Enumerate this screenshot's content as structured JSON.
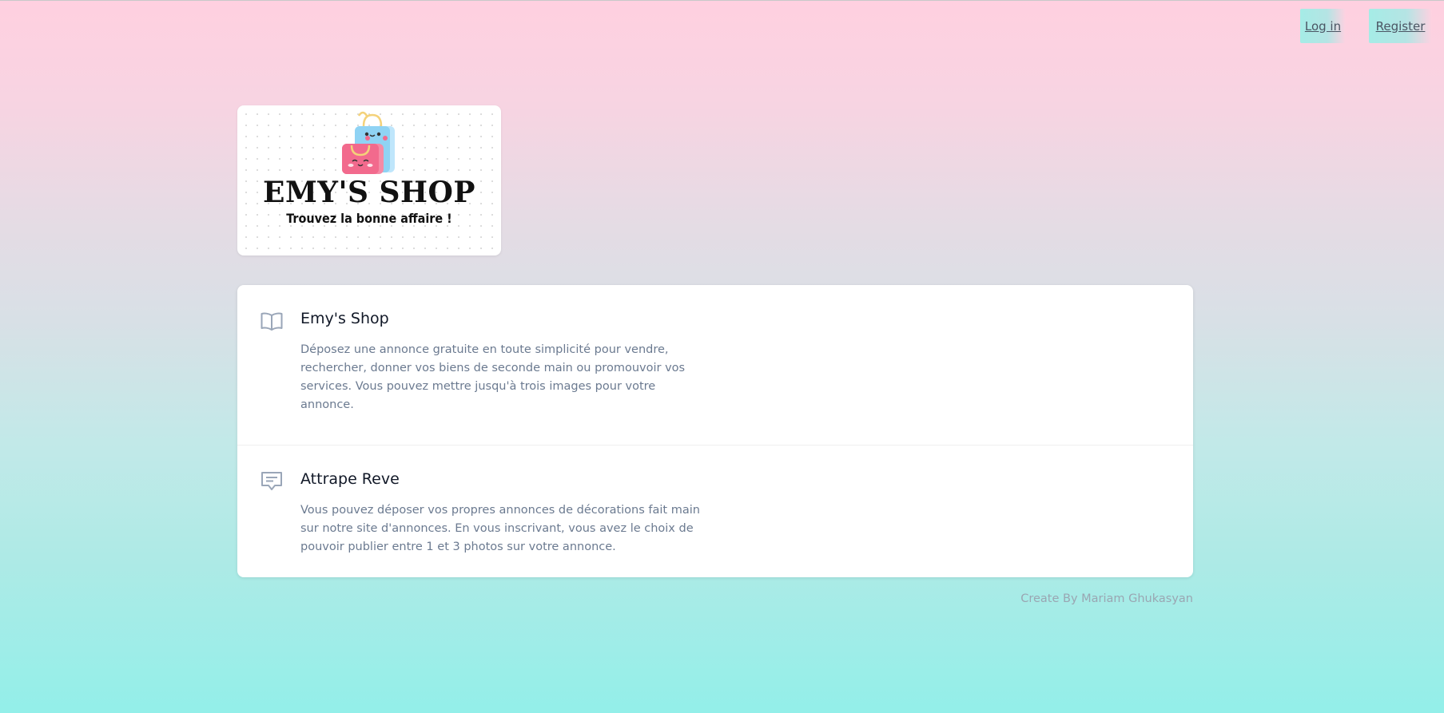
{
  "nav": {
    "login_label": "Log in",
    "register_label": "Register"
  },
  "logo": {
    "title": "EMY'S SHOP",
    "tagline": "Trouvez la bonne affaire !"
  },
  "features": [
    {
      "icon": "open-book-icon",
      "title": "Emy's Shop",
      "text": "Déposez une annonce gratuite en toute simplicité pour vendre, rechercher, donner vos biens de seconde main ou promouvoir vos services. Vous pouvez mettre jusqu'à trois images pour votre annonce."
    },
    {
      "icon": "chat-bubble-icon",
      "title": "Attrape Reve",
      "text": "Vous pouvez déposer vos propres annonces de décorations fait main sur notre site d'annonces. En vous inscrivant, vous avez le choix de pouvoir publier entre 1 et 3 photos sur votre annonce."
    }
  ],
  "footer": {
    "credit": "Create By Mariam Ghukasyan"
  },
  "colors": {
    "gradient_top": "#ffd0e0",
    "gradient_bottom": "#93efe9",
    "text_muted": "#6b7a90",
    "bag_pink": "#f26a8d",
    "bag_blue": "#8fd3f4"
  }
}
